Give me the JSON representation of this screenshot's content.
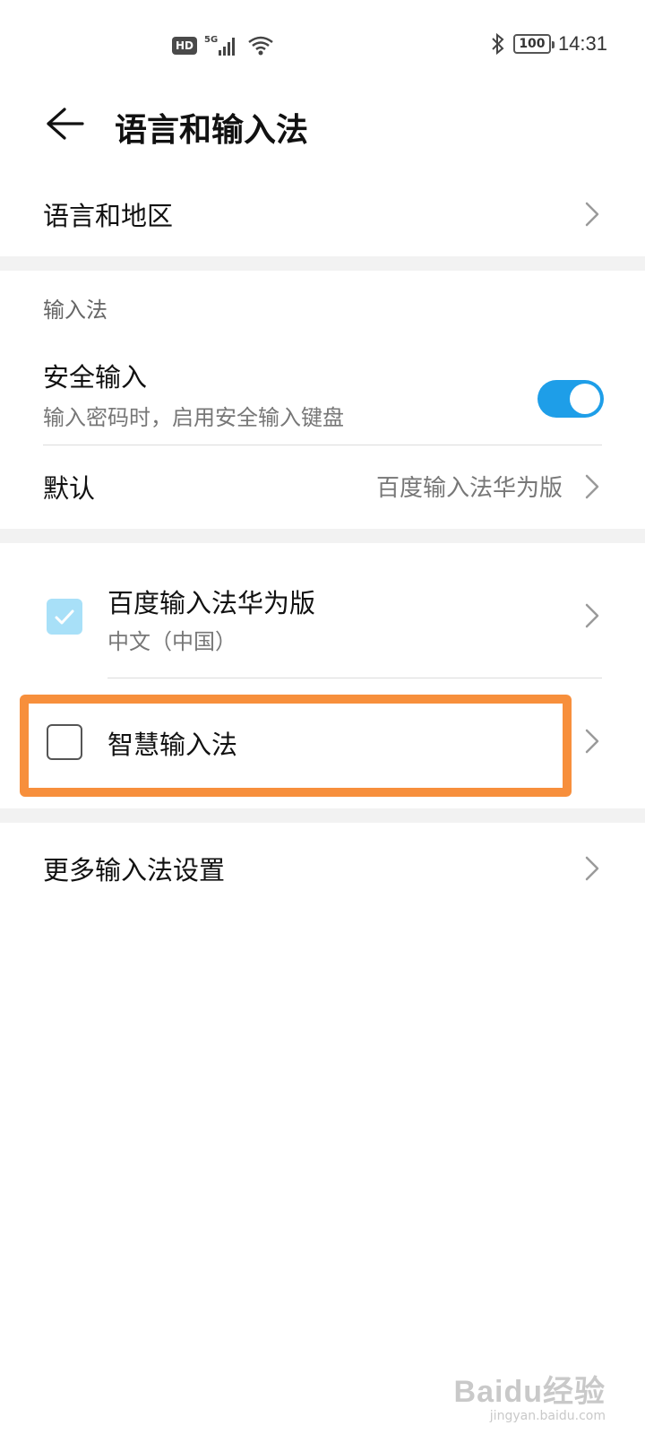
{
  "status_bar": {
    "hd_badge": "HD",
    "network": "5G",
    "battery": "100",
    "time": "14:31"
  },
  "header": {
    "title": "语言和输入法"
  },
  "language_region": {
    "label": "语言和地区"
  },
  "input_methods": {
    "section_title": "输入法",
    "secure_input": {
      "label": "安全输入",
      "description": "输入密码时，启用安全输入键盘",
      "enabled": true
    },
    "default": {
      "label": "默认",
      "value": "百度输入法华为版"
    },
    "list": [
      {
        "name": "百度输入法华为版",
        "sub": "中文（中国）",
        "checked": true
      },
      {
        "name": "智慧输入法",
        "sub": "",
        "checked": false
      }
    ]
  },
  "more": {
    "label": "更多输入法设置"
  },
  "watermark": {
    "logo": "Baidu经验",
    "url": "jingyan.baidu.com"
  },
  "colors": {
    "accent": "#1e9ee8",
    "highlight": "#f78f3c"
  }
}
